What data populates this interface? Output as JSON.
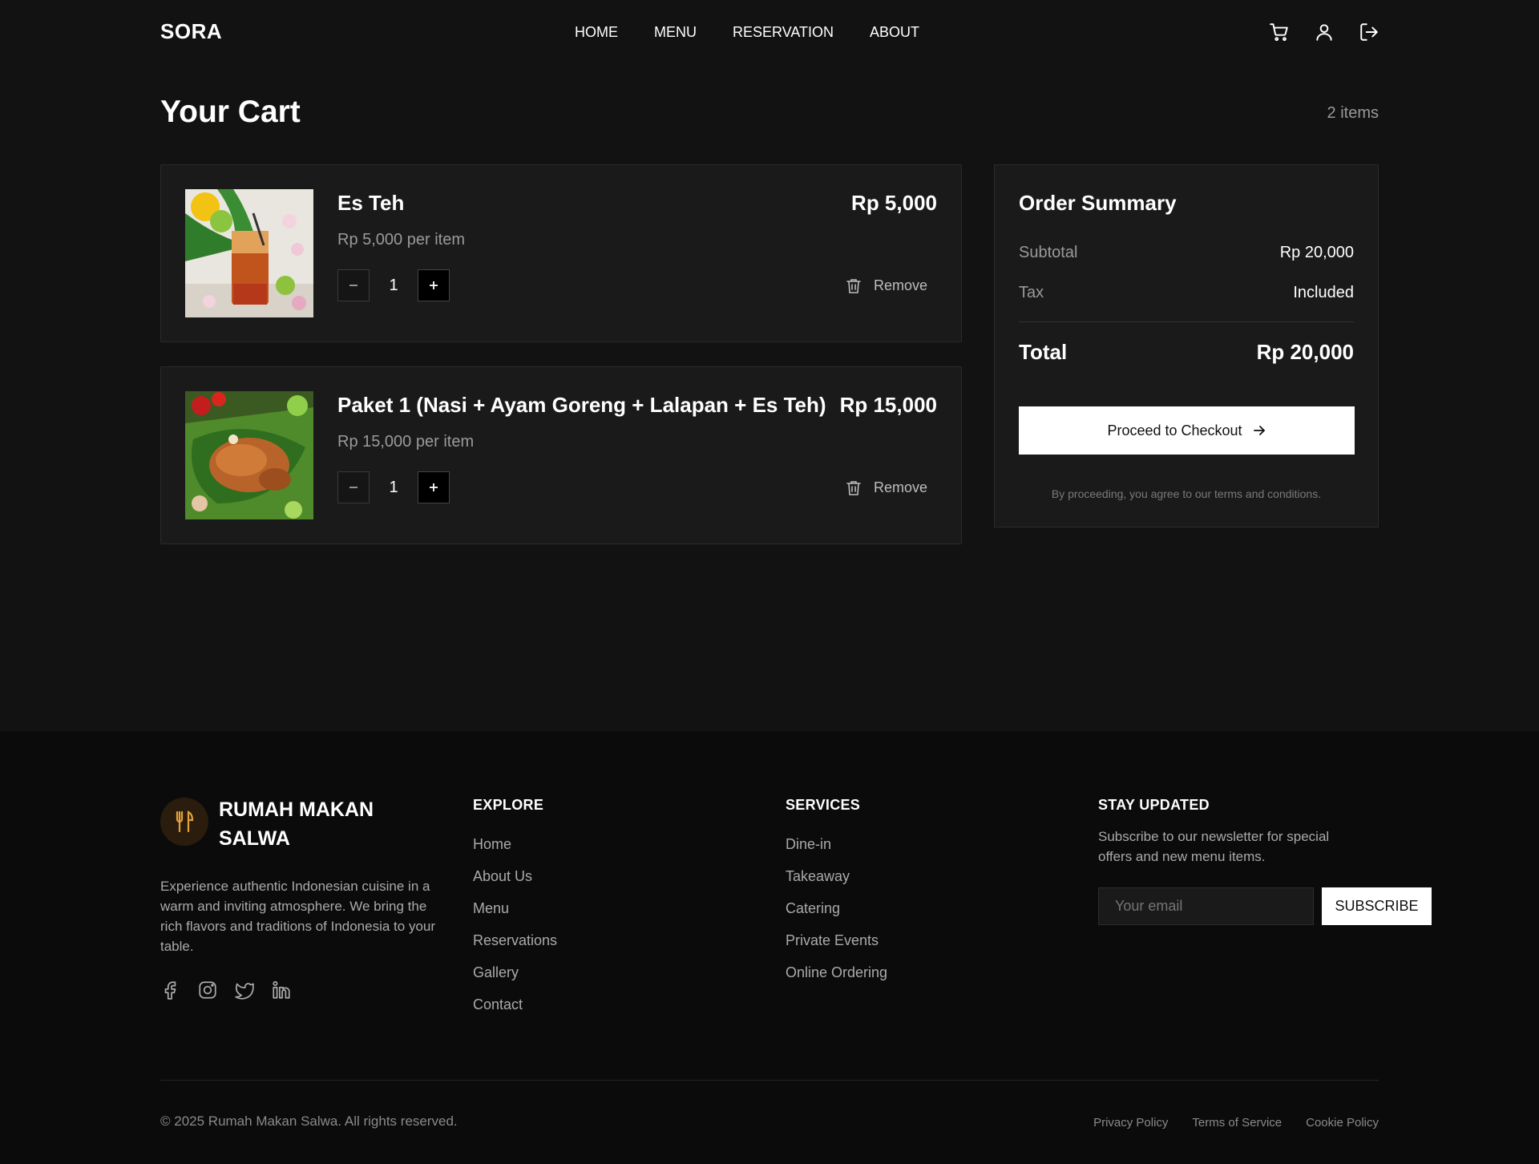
{
  "header": {
    "logo": "SORA",
    "nav": [
      "HOME",
      "MENU",
      "RESERVATION",
      "ABOUT"
    ],
    "icons": [
      "cart-icon",
      "user-icon",
      "logout-icon"
    ]
  },
  "cart": {
    "title": "Your Cart",
    "count_label": "2 items",
    "items": [
      {
        "name": "Es Teh",
        "price": "Rp 5,000",
        "unit_price": "Rp 5,000 per item",
        "quantity": "1",
        "remove_label": "Remove",
        "image": "iced-tea-photo"
      },
      {
        "name": "Paket 1 (Nasi + Ayam Goreng + Lalapan + Es Teh)",
        "price": "Rp 15,000",
        "unit_price": "Rp 15,000 per item",
        "quantity": "1",
        "remove_label": "Remove",
        "image": "fried-chicken-photo"
      }
    ]
  },
  "summary": {
    "title": "Order Summary",
    "subtotal_label": "Subtotal",
    "subtotal_value": "Rp 20,000",
    "tax_label": "Tax",
    "tax_value": "Included",
    "total_label": "Total",
    "total_value": "Rp 20,000",
    "checkout_label": "Proceed to Checkout",
    "terms": "By proceeding, you agree to our terms and conditions."
  },
  "footer": {
    "brand_name": "RUMAH MAKAN SALWA",
    "brand_desc": "Experience authentic Indonesian cuisine in a warm and inviting atmosphere. We bring the rich flavors and traditions of Indonesia to your table.",
    "socials": [
      "facebook-icon",
      "instagram-icon",
      "twitter-icon",
      "linkedin-icon"
    ],
    "explore": {
      "title": "EXPLORE",
      "links": [
        "Home",
        "About Us",
        "Menu",
        "Reservations",
        "Gallery",
        "Contact"
      ]
    },
    "services": {
      "title": "SERVICES",
      "links": [
        "Dine-in",
        "Takeaway",
        "Catering",
        "Private Events",
        "Online Ordering"
      ]
    },
    "newsletter": {
      "title": "STAY UPDATED",
      "desc": "Subscribe to our newsletter for special offers and new menu items.",
      "placeholder": "Your email",
      "button": "SUBSCRIBE"
    },
    "copyright": "© 2025 Rumah Makan Salwa. All rights reserved.",
    "legal": [
      "Privacy Policy",
      "Terms of Service",
      "Cookie Policy"
    ]
  },
  "colors": {
    "background": "#121212",
    "card": "#1a1a1a",
    "footer": "#0b0b0b",
    "accent": "#e3a23a"
  }
}
